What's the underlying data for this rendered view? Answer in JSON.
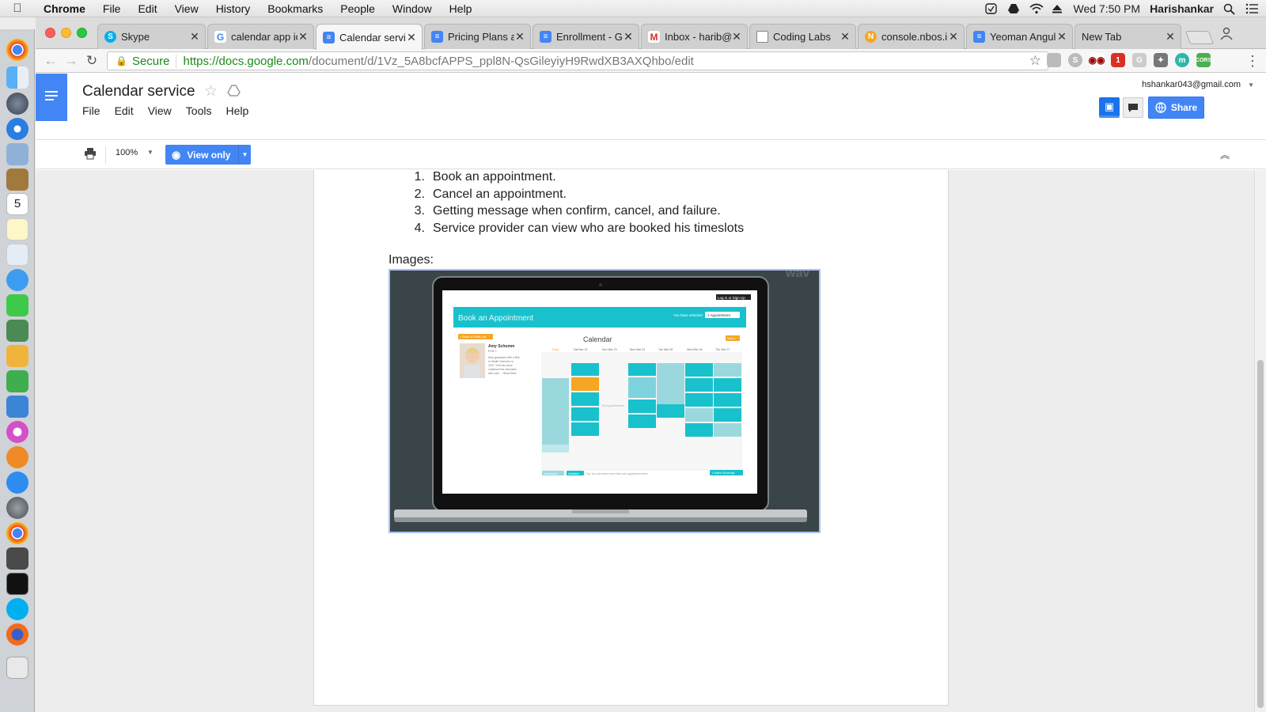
{
  "menubar": {
    "app": "Chrome",
    "items": [
      "File",
      "Edit",
      "View",
      "History",
      "Bookmarks",
      "People",
      "Window",
      "Help"
    ],
    "clock": "Wed 7:50 PM",
    "user": "Harishankar"
  },
  "tabs": [
    {
      "title": "Skype",
      "favicon": "skype-icon",
      "color": "#00aff0"
    },
    {
      "title": "calendar app ic",
      "favicon": "google-icon",
      "color": "#4285f4"
    },
    {
      "title": "Calendar servic",
      "favicon": "docs-icon",
      "color": "#4285f4",
      "active": true
    },
    {
      "title": "Pricing Plans a",
      "favicon": "docs-icon",
      "color": "#4285f4"
    },
    {
      "title": "Enrollment - G",
      "favicon": "docs-icon",
      "color": "#4285f4"
    },
    {
      "title": "Inbox - harib@",
      "favicon": "gmail-icon",
      "color": "#d93025"
    },
    {
      "title": "Coding Labs",
      "favicon": "page-icon",
      "color": "#888888"
    },
    {
      "title": "console.nbos.i",
      "favicon": "nbos-icon",
      "color": "#f5a623"
    },
    {
      "title": "Yeoman Angul",
      "favicon": "docs-icon",
      "color": "#4285f4"
    },
    {
      "title": "New Tab",
      "favicon": "",
      "color": ""
    }
  ],
  "address": {
    "secure_label": "Secure",
    "url_host": "https://docs.google.com",
    "url_path": "/document/d/1Vz_5A8bcfAPPS_ppl8N-QsGileyiyH9RwdXB3AXQhbo/edit"
  },
  "docs": {
    "title": "Calendar service",
    "menu": [
      "File",
      "Edit",
      "View",
      "Tools",
      "Help"
    ],
    "account": "hshankar043@gmail.com",
    "share_label": "Share",
    "zoom": "100%",
    "mode_label": "View only"
  },
  "content": {
    "steps": [
      {
        "num": "1.",
        "text": "Book an appointment."
      },
      {
        "num": "2.",
        "text": "Cancel an appointment."
      },
      {
        "num": "3.",
        "text": "Getting message when confirm, cancel, and failure."
      },
      {
        "num": "4.",
        "text": "Service provider can view who are booked his timeslots"
      }
    ],
    "images_label": "Images:",
    "mockup": {
      "header": "Book an Appointment",
      "you_have_selected": "You have selected",
      "selected": "1 Appointment",
      "login": "Log in or Sign Up",
      "back_btn": "< Back to Staff List",
      "next_btn": "Next >",
      "calendar_title": "Calendar",
      "provider_name": "Amy Schumm",
      "provider_role": "R.M.T.",
      "provider_bio": [
        "Amy graduated with a BSc",
        "in Health Sciences in",
        "2007. She has since",
        "continued her education",
        "with such ... Read More"
      ],
      "days": [
        "Today",
        "Sat Mar 22",
        "Sun Mar 23",
        "Mon Mar 24",
        "Tue Mar 25",
        "Wed Mar 26",
        "Thu Mar 27"
      ],
      "no_appointments": "No Appointments",
      "legend_unavailable": "Unavailable",
      "legend_available": "Available",
      "tip": "Tip: You can select more than one appointment time.",
      "confirm_btn": "Confirm Bookings",
      "watermark": "wav"
    }
  },
  "colors": {
    "accent": "#4285f4",
    "teal": "#19c1cc",
    "orange": "#f5a623",
    "secure_green": "#1b8a1b"
  }
}
